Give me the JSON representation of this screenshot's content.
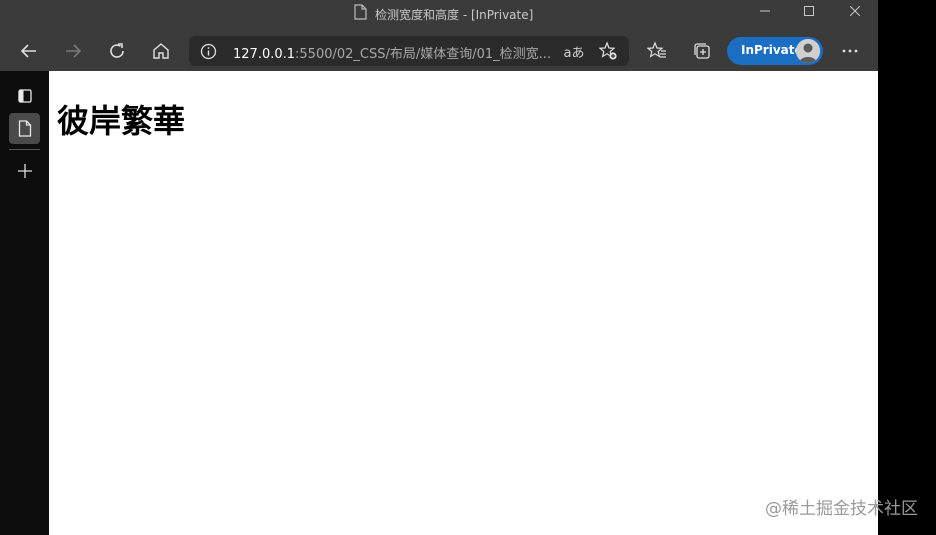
{
  "window": {
    "title": "检测宽度和高度 - [InPrivate]",
    "accent_color": "#1a6fc4"
  },
  "toolbar": {
    "address_host": "127.0.0.1",
    "address_rest": ":5500/02_CSS/布局/媒体查询/01_检测宽...",
    "read_aloud_glyph": "aあ",
    "inprivate_label": "InPrivate",
    "icons": [
      "back-icon",
      "forward-icon",
      "refresh-icon",
      "home-icon",
      "info-icon",
      "add-favorite-icon",
      "favorites-icon",
      "collections-icon",
      "more-icon"
    ]
  },
  "tabstrip": {
    "icons": [
      "tab-actions-icon",
      "page-tab-icon",
      "new-tab-icon"
    ]
  },
  "page": {
    "heading": "彼岸繁華"
  },
  "watermark": "@稀土掘金技术社区"
}
